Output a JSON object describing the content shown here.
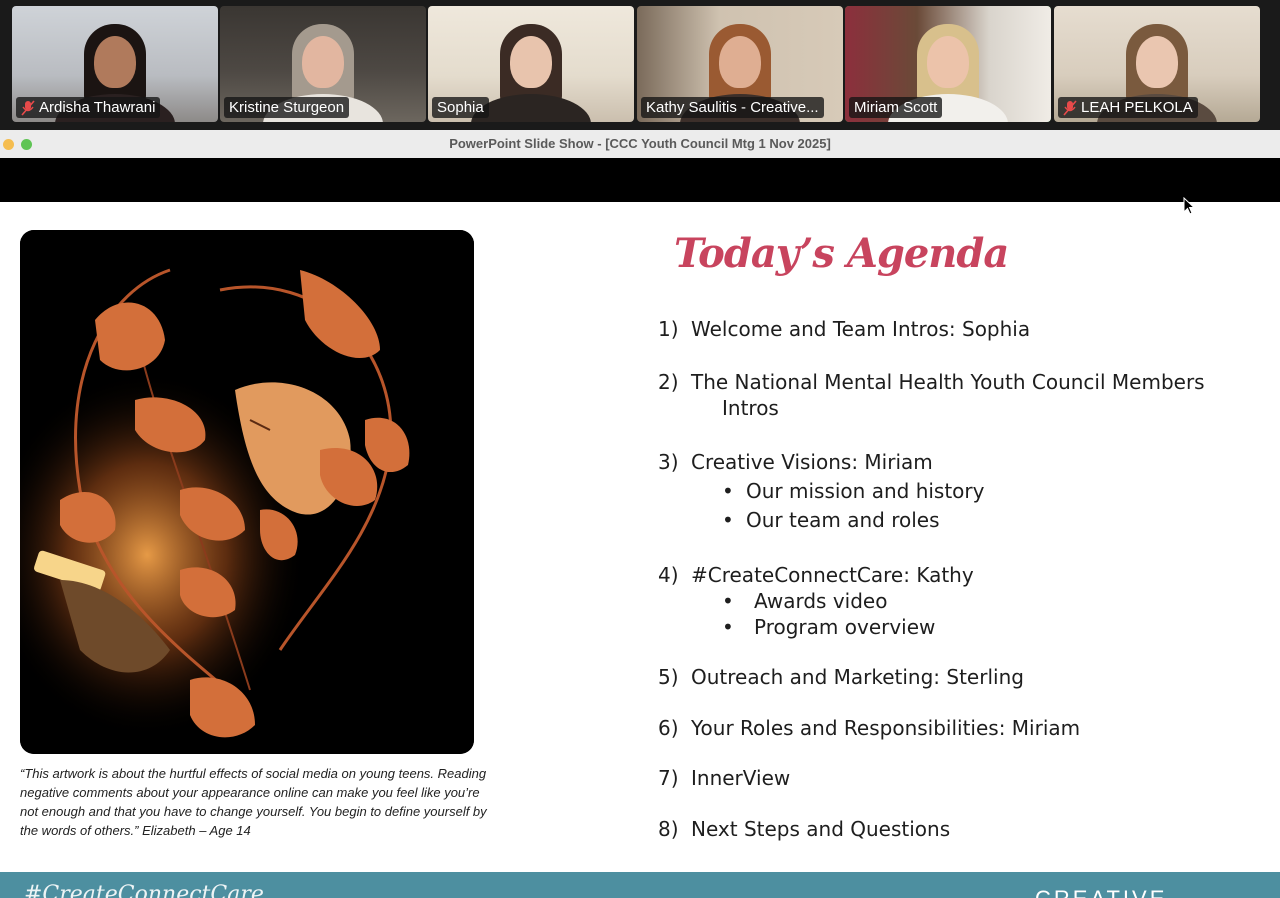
{
  "participants": [
    {
      "name": "Ardisha Thawrani",
      "muted": true,
      "active": false
    },
    {
      "name": "Kristine Sturgeon",
      "muted": false,
      "active": false
    },
    {
      "name": "Sophia",
      "muted": false,
      "active": false
    },
    {
      "name": "Kathy Saulitis - Creative...",
      "muted": false,
      "active": false
    },
    {
      "name": "Miriam Scott",
      "muted": false,
      "active": true
    },
    {
      "name": "LEAH PELKOLA",
      "muted": true,
      "active": false
    }
  ],
  "window": {
    "title": "PowerPoint Slide Show - [CCC Youth Council Mtg 1 Nov 2025]"
  },
  "slide": {
    "caption": "“This artwork is about the hurtful effects of social media on young teens. Reading negative comments about your appearance online can make you feel like you’re not enough and that you have to change yourself. You begin to define yourself by the words of others.” Elizabeth – Age 14",
    "agenda_title": "Today’s Agenda",
    "items": [
      {
        "num": "1)",
        "text": "Welcome and Team Intros:  Sophia"
      },
      {
        "num": "2)",
        "text": "The National Mental Health Youth Council Members",
        "cont": "Intros"
      },
      {
        "num": "3)",
        "text": "Creative Visions:  Miriam",
        "subs": [
          "Our mission and history",
          "Our team and roles"
        ]
      },
      {
        "num": "4)",
        "text": "#CreateConnectCare: Kathy",
        "subs": [
          "Awards video",
          "Program overview"
        ]
      },
      {
        "num": "5)",
        "text": "Outreach and Marketing: Sterling"
      },
      {
        "num": "6)",
        "text": "Your Roles and Responsibilities: Miriam"
      },
      {
        "num": "7)",
        "text": "InnerView"
      },
      {
        "num": "8)",
        "text": "Next Steps and Questions"
      }
    ],
    "bullet": "•",
    "footer_tagline": "#CreateConnectCare",
    "footer_brand": "CREATIVE"
  },
  "colors": {
    "accent": "#c8445e",
    "footer": "#4d8fa0",
    "active_speaker": "#46c25a"
  }
}
